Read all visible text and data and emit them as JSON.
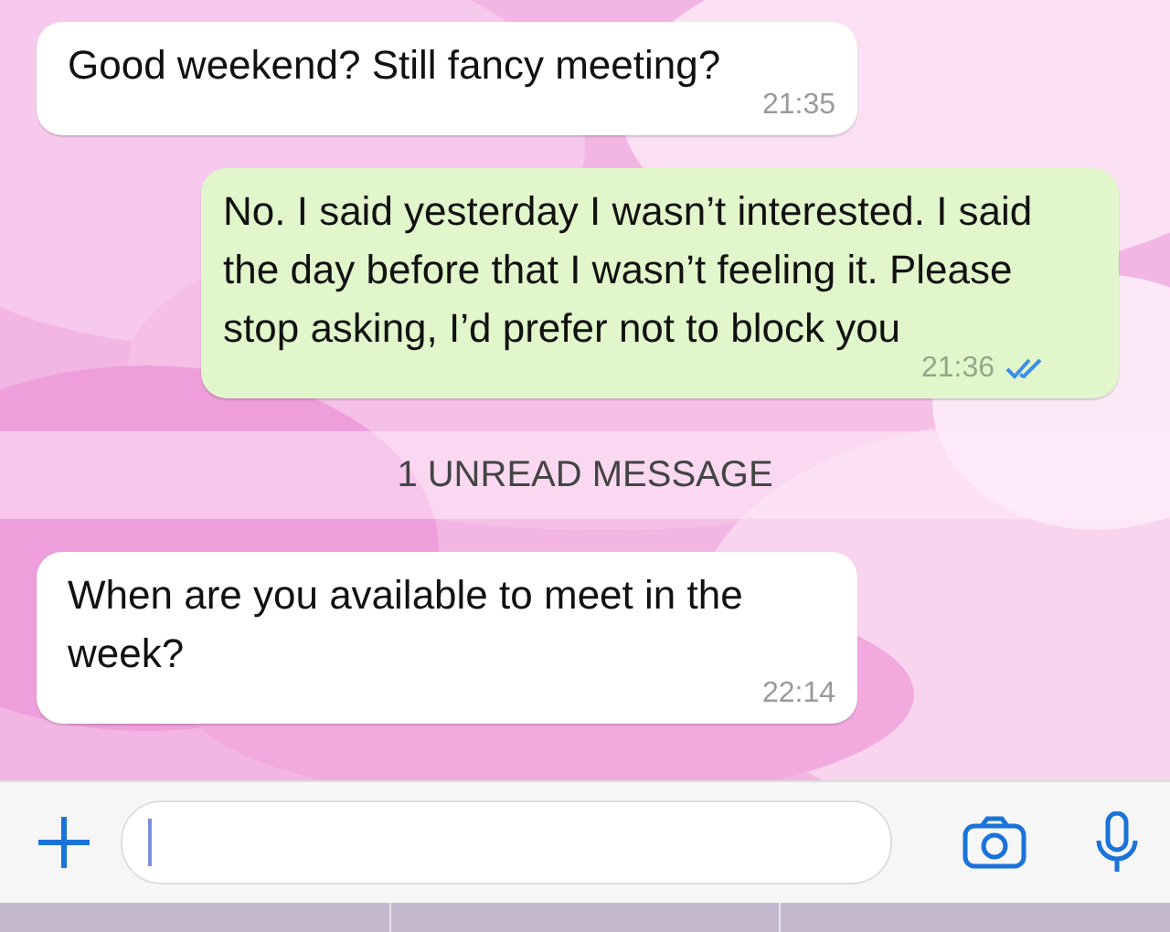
{
  "messages": [
    {
      "kind": "incoming",
      "text": "Good weekend? Still fancy meeting?",
      "time": "21:35"
    },
    {
      "kind": "outgoing",
      "text": "No. I said yesterday I wasn’t interested. I said the day before that I wasn’t feeling it. Please stop asking, I’d prefer not to block you",
      "time": "21:36",
      "read": true
    },
    {
      "kind": "unread_divider",
      "text": "1 UNREAD MESSAGE"
    },
    {
      "kind": "incoming",
      "text": "When are you available to meet in the week?",
      "time": "22:14"
    }
  ]
}
